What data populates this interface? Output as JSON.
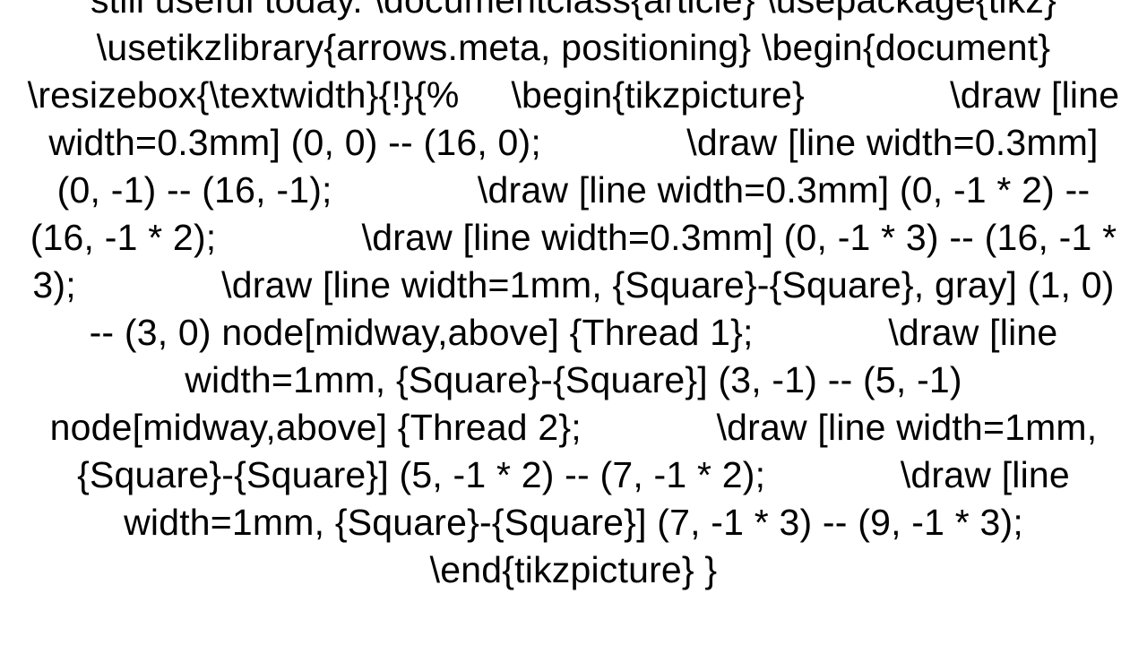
{
  "document": {
    "code_text": "still useful today. \\documentclass{article} \\usepackage{tikz} \\usetikzlibrary{arrows.meta, positioning} \\begin{document}  \\resizebox{\\textwidth}{!}{%     \\begin{tikzpicture}              \\draw [line width=0.3mm] (0, 0) -- (16, 0);              \\draw [line width=0.3mm] (0, -1) -- (16, -1);              \\draw [line width=0.3mm] (0, -1 * 2) -- (16, -1 * 2);              \\draw [line width=0.3mm] (0, -1 * 3) -- (16, -1 * 3);              \\draw [line width=1mm, {Square}-{Square}, gray] (1, 0) -- (3, 0) node[midway,above] {Thread 1};             \\draw [line width=1mm, {Square}-{Square}] (3, -1) -- (5, -1) node[midway,above] {Thread 2};             \\draw [line width=1mm, {Square}-{Square}] (5, -1 * 2) -- (7, -1 * 2);             \\draw [line width=1mm, {Square}-{Square}] (7, -1 * 3) -- (9, -1 * 3);                  \\end{tikzpicture} }"
  }
}
